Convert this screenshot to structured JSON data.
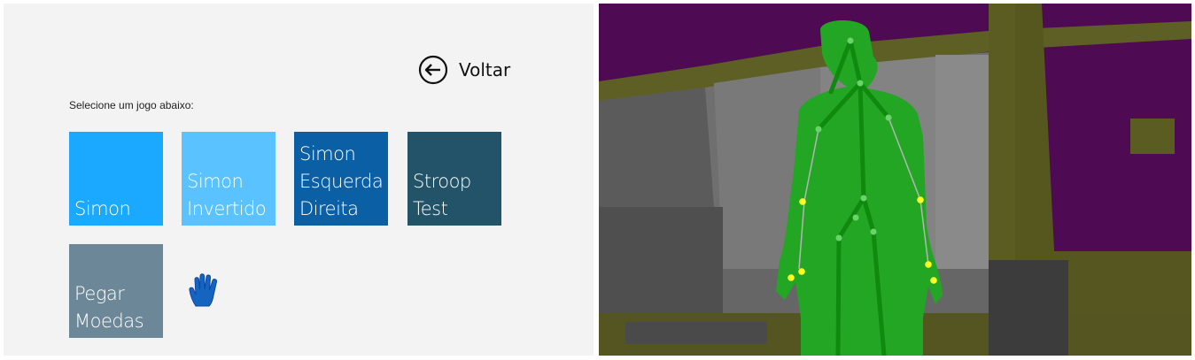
{
  "menu": {
    "back_label": "Voltar",
    "instruction": "Selecione um jogo abaixo:",
    "tiles": [
      {
        "label": "Simon",
        "color": "#1ba9ff"
      },
      {
        "label": "Simon\nInvertido",
        "color": "#5ac2fe"
      },
      {
        "label": "Simon\nEsquerda\nDireita",
        "color": "#0b5fa5"
      },
      {
        "label": "Stroop\nTest",
        "color": "#235368"
      },
      {
        "label": "Pegar\nMoedas",
        "color": "#6b8798"
      }
    ]
  },
  "depth_view": {
    "background_color": "#4e0a53",
    "body_color": "#23a623",
    "skeleton_bone_color": "#0f8a0f",
    "joint_color": "#6ad36a",
    "hand_joint_color": "#ffff22",
    "floor_color": "#575920"
  },
  "colors": {
    "panel_background": "#f3f3f3",
    "hand_cursor": "#1565c0"
  }
}
